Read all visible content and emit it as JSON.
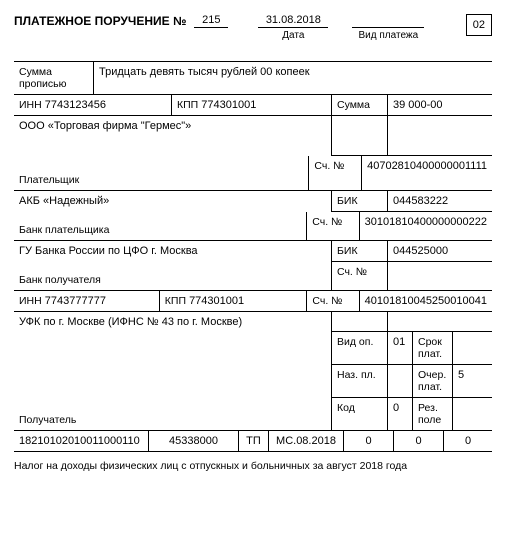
{
  "header": {
    "title": "ПЛАТЕЖНОЕ ПОРУЧЕНИЕ №",
    "number": "215",
    "date": "31.08.2018",
    "date_label": "Дата",
    "paytype_label": "Вид платежа",
    "paytype_value": "",
    "code": "02"
  },
  "sum_words": {
    "label": "Сумма прописью",
    "value": "Тридцать девять тысяч рублей 00 копеек"
  },
  "payer": {
    "inn_label": "ИНН",
    "inn": "7743123456",
    "kpp_label": "КПП",
    "kpp": "774301001",
    "sum_label": "Сумма",
    "sum_value": "39 000-00",
    "name": "ООО «Торговая фирма \"Гермес\"»",
    "acct_label": "Сч. №",
    "acct": "40702810400000001111",
    "payer_label": "Плательщик"
  },
  "payer_bank": {
    "name": "АКБ «Надежный»",
    "bic_label": "БИК",
    "bic": "044583222",
    "acct_label": "Сч. №",
    "acct": "30101810400000000222",
    "label": "Банк плательщика"
  },
  "recip_bank": {
    "name": "ГУ Банка России по ЦФО г. Москва",
    "bic_label": "БИК",
    "bic": "044525000",
    "acct_label": "Сч. №",
    "acct": "",
    "label": "Банк получателя"
  },
  "recipient": {
    "inn_label": "ИНН",
    "inn": "7743777777",
    "kpp_label": "КПП",
    "kpp": "774301001",
    "acct_label": "Сч. №",
    "acct": "40101810045250010041",
    "name": "УФК по г. Москве (ИФНС № 43 по г. Москве)",
    "vid_op_label": "Вид оп.",
    "vid_op": "01",
    "srok_label": "Срок плат.",
    "srok": "",
    "naz_pl_label": "Наз. пл.",
    "naz_pl": "",
    "ocher_label": "Очер. плат.",
    "ocher": "5",
    "code_label": "Код",
    "code": "0",
    "rez_label": "Рез. поле",
    "rez": "",
    "recip_label": "Получатель"
  },
  "footer_row": {
    "f1": "18210102010011000110",
    "f2": "45338000",
    "f3": "ТП",
    "f4": "МС.08.2018",
    "f5": "0",
    "f6": "0",
    "f7": "0"
  },
  "footer_note": "Налог на доходы физических лиц с отпускных и больничных за август 2018 года"
}
